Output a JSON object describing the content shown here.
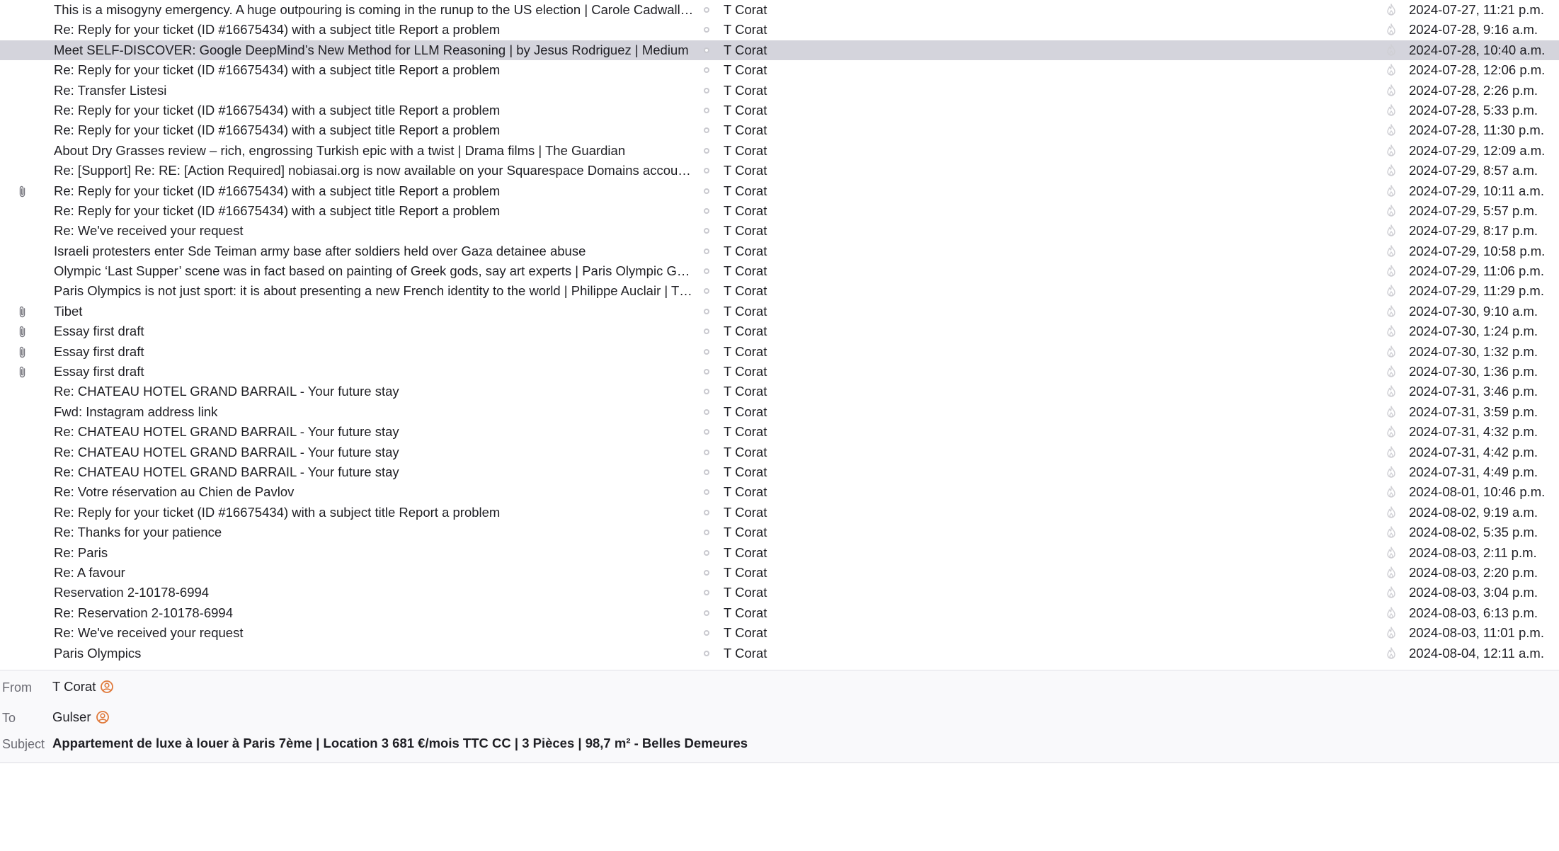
{
  "colors": {
    "selected_row": "#d4d4dc",
    "text": "#1f1f24",
    "muted_icon": "#c9c9cf",
    "contact_icon": "#e07a3c"
  },
  "icons": {
    "attachment": "paperclip-icon",
    "read_status": "read-dot-icon",
    "junk_status": "flame-icon",
    "contact": "contact-avatar-icon"
  },
  "messages": [
    {
      "subject": "This is a misogyny emergency. A huge outpouring is coming in the runup to the US election | Carole Cadwalladr ...",
      "sender": "T Corat",
      "date": "2024-07-27, 11:21 p.m.",
      "attachment": false,
      "selected": false
    },
    {
      "subject": "Re: Reply for your ticket (ID #16675434) with a subject title Report a problem",
      "sender": "T Corat",
      "date": "2024-07-28, 9:16 a.m.",
      "attachment": false,
      "selected": false
    },
    {
      "subject": "Meet SELF-DISCOVER: Google DeepMind’s New Method for LLM Reasoning | by Jesus Rodriguez | Medium",
      "sender": "T Corat",
      "date": "2024-07-28, 10:40 a.m.",
      "attachment": false,
      "selected": true
    },
    {
      "subject": "Re: Reply for your ticket (ID #16675434) with a subject title Report a problem",
      "sender": "T Corat",
      "date": "2024-07-28, 12:06 p.m.",
      "attachment": false,
      "selected": false
    },
    {
      "subject": "Re: Transfer Listesi",
      "sender": "T Corat",
      "date": "2024-07-28, 2:26 p.m.",
      "attachment": false,
      "selected": false
    },
    {
      "subject": "Re: Reply for your ticket (ID #16675434) with a subject title Report a problem",
      "sender": "T Corat",
      "date": "2024-07-28, 5:33 p.m.",
      "attachment": false,
      "selected": false
    },
    {
      "subject": "Re: Reply for your ticket (ID #16675434) with a subject title Report a problem",
      "sender": "T Corat",
      "date": "2024-07-28, 11:30 p.m.",
      "attachment": false,
      "selected": false
    },
    {
      "subject": "About Dry Grasses review – rich, engrossing Turkish epic with a twist | Drama films | The Guardian",
      "sender": "T Corat",
      "date": "2024-07-29, 12:09 a.m.",
      "attachment": false,
      "selected": false
    },
    {
      "subject": "Re: [Support] Re: RE: [Action Required] nobiasai.org is now available on your Squarespace Domains account | Up...",
      "sender": "T Corat",
      "date": "2024-07-29, 8:57 a.m.",
      "attachment": false,
      "selected": false
    },
    {
      "subject": "Re: Reply for your ticket (ID #16675434) with a subject title Report a problem",
      "sender": "T Corat",
      "date": "2024-07-29, 10:11 a.m.",
      "attachment": true,
      "selected": false
    },
    {
      "subject": "Re: Reply for your ticket (ID #16675434) with a subject title Report a problem",
      "sender": "T Corat",
      "date": "2024-07-29, 5:57 p.m.",
      "attachment": false,
      "selected": false
    },
    {
      "subject": "Re: We've received your request",
      "sender": "T Corat",
      "date": "2024-07-29, 8:17 p.m.",
      "attachment": false,
      "selected": false
    },
    {
      "subject": "Israeli protesters enter Sde Teiman army base after soldiers held over Gaza detainee abuse",
      "sender": "T Corat",
      "date": "2024-07-29, 10:58 p.m.",
      "attachment": false,
      "selected": false
    },
    {
      "subject": "Olympic ‘Last Supper’ scene was in fact based on painting of Greek gods, say art experts | Paris Olympic Games ...",
      "sender": "T Corat",
      "date": "2024-07-29, 11:06 p.m.",
      "attachment": false,
      "selected": false
    },
    {
      "subject": "Paris Olympics is not just sport: it is about presenting a new French identity to the world | Philippe Auclair | The ...",
      "sender": "T Corat",
      "date": "2024-07-29, 11:29 p.m.",
      "attachment": false,
      "selected": false
    },
    {
      "subject": "Tibet",
      "sender": "T Corat",
      "date": "2024-07-30, 9:10 a.m.",
      "attachment": true,
      "selected": false
    },
    {
      "subject": "Essay first draft",
      "sender": "T Corat",
      "date": "2024-07-30, 1:24 p.m.",
      "attachment": true,
      "selected": false
    },
    {
      "subject": "Essay first draft",
      "sender": "T Corat",
      "date": "2024-07-30, 1:32 p.m.",
      "attachment": true,
      "selected": false
    },
    {
      "subject": "Essay first draft",
      "sender": "T Corat",
      "date": "2024-07-30, 1:36 p.m.",
      "attachment": true,
      "selected": false
    },
    {
      "subject": "Re: CHATEAU HOTEL GRAND BARRAIL - Your future stay",
      "sender": "T Corat",
      "date": "2024-07-31, 3:46 p.m.",
      "attachment": false,
      "selected": false
    },
    {
      "subject": "Fwd: Instagram address link",
      "sender": "T Corat",
      "date": "2024-07-31, 3:59 p.m.",
      "attachment": false,
      "selected": false
    },
    {
      "subject": "Re: CHATEAU HOTEL GRAND BARRAIL - Your future stay",
      "sender": "T Corat",
      "date": "2024-07-31, 4:32 p.m.",
      "attachment": false,
      "selected": false
    },
    {
      "subject": "Re: CHATEAU HOTEL GRAND BARRAIL - Your future stay",
      "sender": "T Corat",
      "date": "2024-07-31, 4:42 p.m.",
      "attachment": false,
      "selected": false
    },
    {
      "subject": "Re: CHATEAU HOTEL GRAND BARRAIL - Your future stay",
      "sender": "T Corat",
      "date": "2024-07-31, 4:49 p.m.",
      "attachment": false,
      "selected": false
    },
    {
      "subject": "Re: Votre réservation au Chien de Pavlov",
      "sender": "T Corat",
      "date": "2024-08-01, 10:46 p.m.",
      "attachment": false,
      "selected": false
    },
    {
      "subject": "Re: Reply for your ticket (ID #16675434) with a subject title Report a problem",
      "sender": "T Corat",
      "date": "2024-08-02, 9:19 a.m.",
      "attachment": false,
      "selected": false
    },
    {
      "subject": "Re: Thanks for your patience",
      "sender": "T Corat",
      "date": "2024-08-02, 5:35 p.m.",
      "attachment": false,
      "selected": false
    },
    {
      "subject": "Re: Paris",
      "sender": "T Corat",
      "date": "2024-08-03, 2:11 p.m.",
      "attachment": false,
      "selected": false
    },
    {
      "subject": "Re: A favour",
      "sender": "T Corat",
      "date": "2024-08-03, 2:20 p.m.",
      "attachment": false,
      "selected": false
    },
    {
      "subject": "Reservation 2-10178-6994",
      "sender": "T Corat",
      "date": "2024-08-03, 3:04 p.m.",
      "attachment": false,
      "selected": false
    },
    {
      "subject": "Re: Reservation 2-10178-6994",
      "sender": "T Corat",
      "date": "2024-08-03, 6:13 p.m.",
      "attachment": false,
      "selected": false
    },
    {
      "subject": "Re: We've received your request",
      "sender": "T Corat",
      "date": "2024-08-03, 11:01 p.m.",
      "attachment": false,
      "selected": false
    },
    {
      "subject": "Paris Olympics",
      "sender": "T Corat",
      "date": "2024-08-04, 12:11 a.m.",
      "attachment": false,
      "selected": false
    }
  ],
  "header": {
    "from_label": "From",
    "from_value": "T Corat",
    "to_label": "To",
    "to_value": "Gulser",
    "subject_label": "Subject",
    "subject_value": "Appartement de luxe à louer à Paris 7ème | Location 3 681 €/mois TTC CC | 3 Pièces | 98,7 m² - Belles Demeures"
  }
}
